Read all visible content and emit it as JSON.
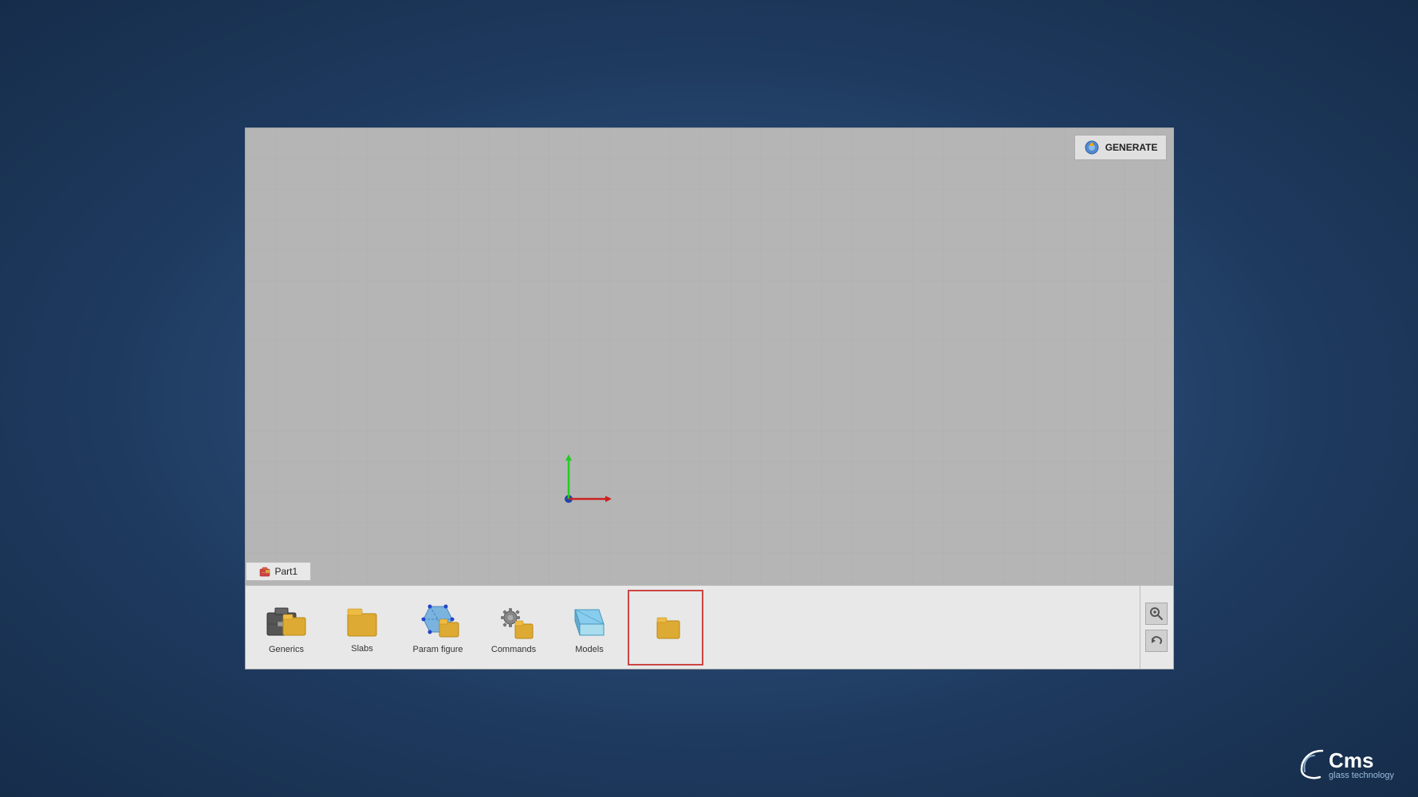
{
  "app": {
    "title": "CMS Glass Technology",
    "window_title": "Part1"
  },
  "generate_button": {
    "label": "GENERATE"
  },
  "tab": {
    "label": "Part1"
  },
  "toolbar": {
    "items": [
      {
        "id": "generics",
        "label": "Generics"
      },
      {
        "id": "slabs",
        "label": "Slabs"
      },
      {
        "id": "param_figure",
        "label": "Param figure"
      },
      {
        "id": "commands",
        "label": "Commands"
      },
      {
        "id": "models",
        "label": "Models"
      },
      {
        "id": "unknown",
        "label": ""
      }
    ]
  },
  "cms_logo": {
    "name": "Cms",
    "tagline": "glass technology"
  },
  "right_tools": {
    "zoom": "🔍",
    "undo": "↩"
  }
}
